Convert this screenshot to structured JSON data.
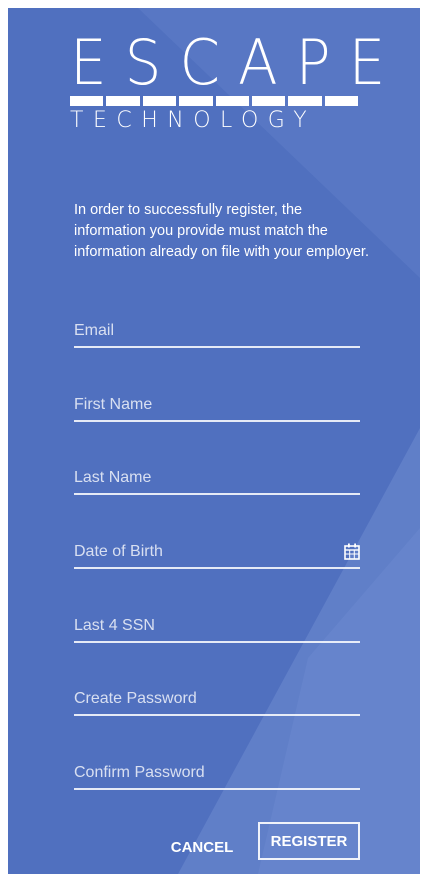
{
  "logo": {
    "word": "ESCAPE",
    "subword": "TECHNOLOGY"
  },
  "intro_text": "In order to successfully register, the information you provide must match the information already on file with your employer.",
  "form": {
    "fields": [
      {
        "placeholder": "Email",
        "value": ""
      },
      {
        "placeholder": "First Name",
        "value": ""
      },
      {
        "placeholder": "Last Name",
        "value": ""
      },
      {
        "placeholder": "Date of Birth",
        "value": "",
        "icon": "calendar-icon"
      },
      {
        "placeholder": "Last 4 SSN",
        "value": ""
      },
      {
        "placeholder": "Create Password",
        "value": ""
      },
      {
        "placeholder": "Confirm Password",
        "value": ""
      }
    ]
  },
  "buttons": {
    "cancel_label": "CANCEL",
    "register_label": "REGISTER"
  },
  "colors": {
    "background": "#5070bf",
    "background_light": "#6584cb",
    "text": "#ffffff"
  }
}
